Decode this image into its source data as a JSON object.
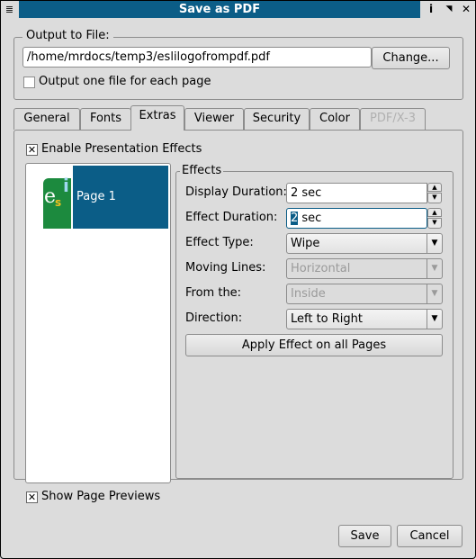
{
  "window": {
    "title": "Save as PDF",
    "menu_icon": "≣",
    "help_icon": "i",
    "shade_icon": "◥",
    "close_icon": "✕"
  },
  "output": {
    "group_label": "Output to File:",
    "path": "/home/mrdocs/temp3/eslilogofrompdf.pdf",
    "change_label": "Change...",
    "one_file_label": "Output one file for each page",
    "one_file_checked": false
  },
  "tabs": [
    {
      "label": "General"
    },
    {
      "label": "Fonts"
    },
    {
      "label": "Extras",
      "active": true
    },
    {
      "label": "Viewer"
    },
    {
      "label": "Security"
    },
    {
      "label": "Color"
    },
    {
      "label": "PDF/X-3",
      "disabled": true
    }
  ],
  "extras": {
    "enable_label": "Enable Presentation Effects",
    "enable_checked": true,
    "pages": [
      {
        "label": "Page 1",
        "selected": true
      }
    ],
    "show_previews_label": "Show Page Previews",
    "show_previews_checked": true,
    "effects": {
      "group_label": "Effects",
      "display_duration_label": "Display Duration:",
      "display_duration": "2 sec",
      "effect_duration_label": "Effect Duration:",
      "effect_duration_sel": "2",
      "effect_duration_rest": " sec",
      "effect_type_label": "Effect Type:",
      "effect_type": "Wipe",
      "moving_lines_label": "Moving Lines:",
      "moving_lines": "Horizontal",
      "from_label": "From the:",
      "from": "Inside",
      "direction_label": "Direction:",
      "direction": "Left to Right",
      "apply_label": "Apply Effect on all Pages"
    }
  },
  "footer": {
    "save_label": "Save",
    "cancel_label": "Cancel"
  },
  "colors": {
    "accent": "#0b5d87"
  }
}
